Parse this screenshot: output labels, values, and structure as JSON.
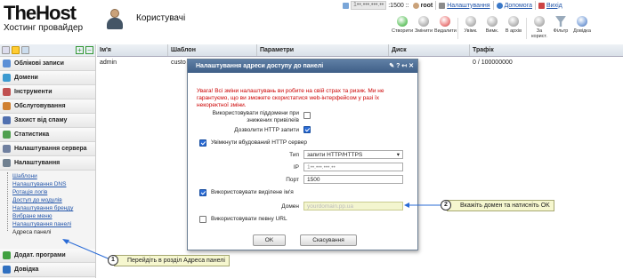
{
  "header": {
    "logo_main": "TheHost",
    "logo_sub": "Хостинг провайдер",
    "page_title": "Користувачі",
    "host_masked": "1••.•••.•••.••",
    "host_suffix": ":1500 ::",
    "user": "root",
    "settings_link": "Налаштування",
    "help_link": "Допомога",
    "exit_link": "Вихід"
  },
  "toolbar": [
    {
      "label": "Створити",
      "icon": "add-icon",
      "kind": "add"
    },
    {
      "label": "Змінити",
      "icon": "edit-icon",
      "kind": ""
    },
    {
      "label": "Видалити",
      "icon": "delete-icon",
      "kind": "del"
    },
    {
      "label": "Увімк.",
      "icon": "bulb-on-icon",
      "kind": ""
    },
    {
      "label": "Вимк.",
      "icon": "bulb-off-icon",
      "kind": ""
    },
    {
      "label": "В архів",
      "icon": "archive-icon",
      "kind": ""
    },
    {
      "label": "За корист.",
      "icon": "user-icon",
      "kind": ""
    },
    {
      "label": "Фільтр",
      "icon": "filter-icon",
      "kind": "filter"
    },
    {
      "label": "Довідка",
      "icon": "help-icon",
      "kind": "help"
    }
  ],
  "sidebar": {
    "sections": [
      {
        "label": "Облікові записи",
        "color": "#5b8fd6"
      },
      {
        "label": "Домени",
        "color": "#3c9ad0"
      },
      {
        "label": "Інструменти",
        "color": "#c05050"
      },
      {
        "label": "Обслуговування",
        "color": "#d08030"
      },
      {
        "label": "Захист від спаму",
        "color": "#5070b0"
      },
      {
        "label": "Статистика",
        "color": "#50a050"
      },
      {
        "label": "Налаштування сервера",
        "color": "#7080a0"
      },
      {
        "label": "Налаштування",
        "color": "#708090"
      }
    ],
    "subitems": [
      "Шаблони",
      "Налаштування DNS",
      "Ротація логів",
      "Доступ до модулів",
      "Налаштування бренду",
      "Вибране меню",
      "Налаштування панелі"
    ],
    "current_item": "Адреса панелі",
    "bottom_sections": [
      {
        "label": "Додат. програми",
        "color": "#40a040"
      },
      {
        "label": "Довідка",
        "color": "#3070c0"
      }
    ]
  },
  "table": {
    "columns": [
      "Ім'я",
      "Шаблон",
      "Параметри",
      "Диск",
      "Трафік"
    ],
    "rows": [
      {
        "name": "admin",
        "template": "custo",
        "disk": "0 / 0",
        "traffic": "0 / 100000000"
      }
    ]
  },
  "dialog": {
    "title": "Налаштування адреси доступу до панелі",
    "title_icons": "✎ ? ↤ ✕",
    "warning": "Увага! Всі зміни налаштувань ви робите на свій страх та ризик. Ми не гарантуємо, що ви зможете скористатися web-інтерфейсом у разі їх некоректної зміни.",
    "subdomains_label_1": "Використовувати піддомени при",
    "subdomains_label_2": "знижених привілеїв",
    "subdomains_checked": false,
    "http_requests_label": "Дозволити HTTP запити",
    "http_requests_checked": true,
    "builtin_http_label": "Увімкнути вбудований HTTP сервер",
    "builtin_http_checked": true,
    "type_label": "Тип",
    "type_value": "запити HTTP/HTTPS",
    "ip_label": "IP",
    "ip_value": "1••.•••.•••.••",
    "port_label": "Порт",
    "port_value": "1500",
    "dedicated_name_label": "Використовувати виділене ім'я",
    "dedicated_name_checked": true,
    "domain_label": "Домен",
    "domain_value": "yourdomain.pp.ua",
    "url_label": "Використовувати певну URL",
    "url_checked": false,
    "ok_label": "OK",
    "cancel_label": "Скасування"
  },
  "callouts": {
    "one_num": "1",
    "one_text": "Перейдіть в розділ Адреса панелі",
    "two_num": "2",
    "two_text": "Вкажіть домен та натисніть OK"
  }
}
